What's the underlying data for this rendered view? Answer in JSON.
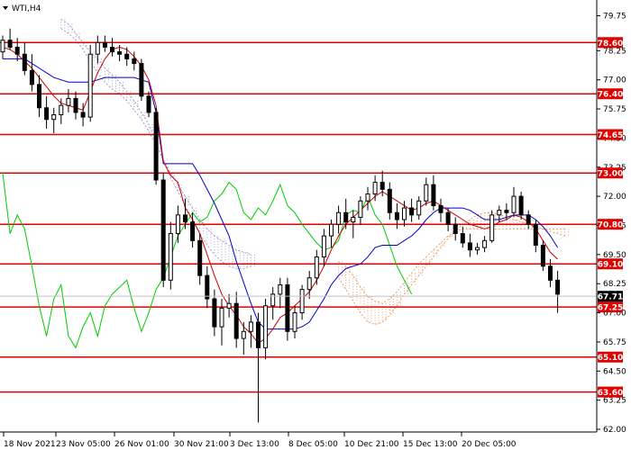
{
  "window": {
    "symbol_label": "WTI,H4",
    "menu_icon": "triangle-down-icon"
  },
  "colors": {
    "background": "#ffffff",
    "candle": "#000000",
    "level_line": "#e00000",
    "level_label_bg": "#e00000",
    "level_label_text": "#ffffff",
    "kijun": "#0000cc",
    "tenkan": "#cc0000",
    "chikou": "#00cc00",
    "cloud_bearish": "#a69ac8",
    "cloud_bullish": "#e8a070",
    "price_line": "#c0c0c0",
    "current_price_bg": "#000000",
    "current_price_text": "#ffffff",
    "axis_text": "#000000"
  },
  "chart_data": {
    "type": "candlestick",
    "symbol": "WTI",
    "timeframe": "H4",
    "ylim": [
      62.0,
      80.0
    ],
    "y_ticks": [
      "79.75",
      "78.25",
      "77.00",
      "75.75",
      "74.50",
      "73.25",
      "72.00",
      "70.75",
      "69.50",
      "68.25",
      "67.00",
      "65.75",
      "64.50",
      "63.25",
      "62.00"
    ],
    "x_ticks": [
      "18 Nov 2021",
      "23 Nov 05:00",
      "26 Nov 01:00",
      "30 Nov 21:00",
      "3 Dec 13:00",
      "8 Dec 05:00",
      "10 Dec 21:00",
      "15 Dec 13:00",
      "20 Dec 05:00"
    ],
    "levels": [
      "78.60",
      "76.40",
      "74.65",
      "73.00",
      "70.80",
      "69.10",
      "67.25",
      "65.10",
      "63.60"
    ],
    "current_price": "67.71",
    "candles": [
      [
        78.2,
        78.9,
        77.9,
        78.7
      ],
      [
        78.7,
        79.2,
        78.3,
        78.4
      ],
      [
        78.4,
        78.8,
        77.8,
        78.1
      ],
      [
        78.1,
        78.6,
        77.2,
        77.4
      ],
      [
        77.4,
        78.1,
        76.5,
        76.8
      ],
      [
        76.8,
        77.2,
        75.4,
        75.8
      ],
      [
        75.8,
        76.3,
        74.9,
        75.3
      ],
      [
        75.3,
        75.8,
        74.7,
        75.5
      ],
      [
        75.5,
        76.2,
        75.1,
        75.9
      ],
      [
        75.9,
        76.6,
        75.6,
        76.2
      ],
      [
        76.2,
        76.5,
        75.3,
        75.6
      ],
      [
        75.6,
        76.0,
        75.0,
        75.4
      ],
      [
        75.4,
        78.5,
        75.2,
        78.1
      ],
      [
        78.1,
        78.9,
        77.7,
        78.6
      ],
      [
        78.6,
        78.9,
        78.2,
        78.4
      ],
      [
        78.4,
        78.8,
        78.0,
        78.2
      ],
      [
        78.2,
        78.5,
        77.8,
        78.1
      ],
      [
        78.1,
        78.4,
        77.6,
        77.9
      ],
      [
        77.9,
        78.2,
        77.4,
        77.7
      ],
      [
        77.7,
        77.9,
        76.1,
        76.3
      ],
      [
        76.3,
        76.5,
        75.4,
        75.6
      ],
      [
        75.6,
        75.8,
        72.5,
        72.7
      ],
      [
        72.7,
        73.0,
        68.1,
        68.4
      ],
      [
        68.4,
        70.9,
        68.0,
        70.4
      ],
      [
        70.4,
        71.6,
        70.0,
        71.2
      ],
      [
        71.2,
        71.9,
        70.6,
        70.9
      ],
      [
        70.9,
        71.3,
        69.8,
        70.1
      ],
      [
        70.1,
        70.4,
        68.2,
        68.6
      ],
      [
        68.6,
        69.0,
        67.2,
        67.6
      ],
      [
        67.6,
        68.0,
        66.0,
        66.4
      ],
      [
        66.4,
        67.6,
        65.6,
        67.2
      ],
      [
        67.2,
        67.8,
        66.8,
        67.4
      ],
      [
        67.4,
        67.9,
        65.5,
        65.9
      ],
      [
        65.9,
        66.6,
        65.2,
        66.2
      ],
      [
        66.2,
        66.9,
        65.5,
        66.6
      ],
      [
        66.6,
        67.0,
        62.3,
        65.5
      ],
      [
        65.5,
        67.6,
        65.0,
        67.3
      ],
      [
        67.3,
        68.1,
        66.7,
        67.8
      ],
      [
        67.8,
        68.5,
        67.2,
        68.2
      ],
      [
        68.2,
        68.5,
        65.8,
        66.2
      ],
      [
        66.2,
        67.3,
        65.9,
        67.0
      ],
      [
        67.0,
        68.2,
        66.7,
        68.0
      ],
      [
        68.0,
        68.8,
        67.6,
        68.5
      ],
      [
        68.5,
        69.7,
        68.2,
        69.4
      ],
      [
        69.4,
        70.6,
        69.0,
        70.3
      ],
      [
        70.3,
        71.0,
        69.8,
        70.8
      ],
      [
        70.8,
        71.6,
        70.4,
        71.3
      ],
      [
        71.3,
        71.9,
        70.6,
        70.9
      ],
      [
        70.9,
        71.4,
        70.2,
        71.1
      ],
      [
        71.1,
        72.0,
        70.8,
        71.8
      ],
      [
        71.8,
        72.4,
        71.4,
        72.1
      ],
      [
        72.1,
        72.9,
        71.8,
        72.6
      ],
      [
        72.6,
        73.1,
        72.0,
        72.3
      ],
      [
        72.3,
        72.6,
        71.0,
        71.3
      ],
      [
        71.3,
        71.7,
        70.6,
        71.0
      ],
      [
        71.0,
        71.8,
        70.7,
        71.5
      ],
      [
        71.5,
        71.9,
        70.9,
        71.2
      ],
      [
        71.2,
        72.0,
        71.0,
        71.8
      ],
      [
        71.8,
        72.8,
        71.6,
        72.5
      ],
      [
        72.5,
        72.9,
        71.4,
        71.6
      ],
      [
        71.6,
        71.9,
        70.9,
        71.3
      ],
      [
        71.3,
        71.5,
        70.5,
        70.8
      ],
      [
        70.8,
        71.1,
        70.1,
        70.4
      ],
      [
        70.4,
        70.7,
        69.8,
        70.0
      ],
      [
        70.0,
        70.4,
        69.4,
        69.7
      ],
      [
        69.7,
        70.0,
        69.5,
        69.8
      ],
      [
        69.8,
        70.3,
        69.6,
        70.1
      ],
      [
        70.1,
        71.4,
        70.0,
        71.2
      ],
      [
        71.2,
        71.6,
        70.9,
        71.4
      ],
      [
        71.4,
        71.7,
        71.0,
        71.3
      ],
      [
        71.3,
        72.4,
        71.1,
        72.0
      ],
      [
        72.0,
        72.2,
        71.0,
        71.2
      ],
      [
        71.2,
        71.4,
        70.6,
        70.8
      ],
      [
        70.8,
        71.0,
        69.6,
        69.9
      ],
      [
        69.9,
        70.1,
        68.8,
        69.0
      ],
      [
        69.0,
        69.3,
        68.1,
        68.4
      ],
      [
        68.4,
        68.8,
        67.0,
        67.8
      ]
    ],
    "tenkan": [
      78.4,
      78.3,
      78.1,
      77.8,
      77.5,
      77.1,
      76.7,
      76.3,
      76.0,
      75.9,
      75.8,
      75.7,
      76.5,
      77.3,
      77.9,
      78.3,
      78.4,
      78.3,
      78.0,
      77.6,
      77.0,
      75.9,
      73.5,
      72.9,
      72.6,
      71.5,
      71.0,
      70.4,
      69.5,
      68.6,
      67.8,
      67.3,
      66.9,
      66.4,
      66.1,
      65.7,
      65.9,
      66.3,
      66.8,
      67.0,
      67.3,
      67.6,
      67.9,
      68.4,
      69.0,
      69.7,
      70.3,
      70.8,
      71.1,
      71.4,
      71.7,
      72.0,
      72.2,
      72.0,
      71.8,
      71.6,
      71.4,
      71.5,
      71.7,
      71.8,
      71.6,
      71.4,
      71.2,
      71.0,
      70.8,
      70.7,
      70.6,
      70.7,
      70.9,
      71.0,
      71.2,
      71.1,
      70.9,
      70.6,
      70.1,
      69.6,
      69.3
    ],
    "kijun": [
      77.9,
      77.9,
      77.9,
      77.9,
      77.7,
      77.5,
      77.3,
      77.1,
      77.0,
      76.9,
      76.9,
      76.9,
      76.9,
      77.0,
      77.1,
      77.1,
      77.1,
      77.1,
      77.1,
      77.0,
      76.9,
      75.6,
      73.4,
      73.4,
      73.4,
      73.4,
      73.4,
      72.9,
      72.3,
      71.7,
      71.0,
      70.3,
      69.2,
      68.3,
      67.4,
      66.6,
      66.3,
      66.3,
      66.3,
      66.3,
      66.3,
      66.4,
      66.6,
      67.1,
      67.6,
      68.2,
      68.6,
      68.9,
      69.0,
      69.1,
      69.4,
      69.8,
      69.9,
      69.9,
      69.9,
      70.1,
      70.3,
      70.6,
      71.0,
      71.3,
      71.5,
      71.5,
      71.5,
      71.5,
      71.4,
      71.2,
      71.0,
      71.0,
      71.0,
      71.1,
      71.2,
      71.2,
      71.2,
      71.0,
      70.7,
      70.3,
      69.8
    ],
    "chikou": [
      73.0,
      70.4,
      71.2,
      70.6,
      69.0,
      67.3,
      66.0,
      67.6,
      68.2,
      66.0,
      65.5,
      66.4,
      67.0,
      66.0,
      67.3,
      67.8,
      68.1,
      68.4,
      67.2,
      66.2,
      67.0,
      68.0,
      68.5,
      69.4,
      70.3,
      70.8,
      71.3,
      70.9,
      71.1,
      71.8,
      72.1,
      72.6,
      72.3,
      71.3,
      71.0,
      71.5,
      71.2,
      71.8,
      72.5,
      71.6,
      71.3,
      70.8,
      70.4,
      70.0,
      69.7,
      69.8,
      70.1,
      71.2,
      71.4,
      71.3,
      72.0,
      71.2,
      70.8,
      69.9,
      69.0,
      68.4,
      67.8
    ],
    "cloud_bearish_a": [
      79.6,
      79.4,
      79.0,
      78.6,
      78.2,
      77.9,
      77.5,
      77.2,
      76.9,
      76.5,
      76.1,
      75.6,
      75.1,
      74.3,
      73.5,
      72.8,
      72.2,
      71.6,
      71.0,
      70.4,
      69.9,
      69.5,
      69.2,
      69.0,
      68.9,
      68.9,
      69.0
    ],
    "cloud_bearish_b": [
      79.2,
      79.0,
      78.7,
      78.3,
      77.8,
      77.3,
      76.9,
      76.6,
      76.4,
      76.1,
      75.7,
      75.3,
      74.8,
      74.2,
      73.6,
      73.0,
      72.5,
      72.0,
      71.5,
      71.0,
      70.6,
      70.3,
      70.1,
      69.9,
      69.7,
      69.6,
      69.5
    ],
    "cloud_bullish_a": [
      68.5,
      68.0,
      67.5,
      67.0,
      66.6,
      66.5,
      66.6,
      66.9,
      67.3,
      67.8,
      68.2,
      68.6,
      69.0,
      69.4,
      69.8,
      70.2,
      70.5,
      70.8,
      71.0,
      71.2,
      71.3,
      71.3,
      71.2,
      71.1,
      71.0,
      70.9,
      70.8,
      70.7,
      70.6,
      70.5,
      70.4,
      70.3
    ],
    "cloud_bullish_b": [
      69.2,
      69.0,
      68.6,
      68.1,
      67.7,
      67.5,
      67.4,
      67.6,
      67.9,
      68.3,
      68.7,
      69.1,
      69.4,
      69.7,
      70.0,
      70.3,
      70.5,
      70.6,
      70.6,
      70.6,
      70.6,
      70.6,
      70.6,
      70.6,
      70.6,
      70.6,
      70.6,
      70.6,
      70.6,
      70.6,
      70.6,
      70.6
    ]
  }
}
